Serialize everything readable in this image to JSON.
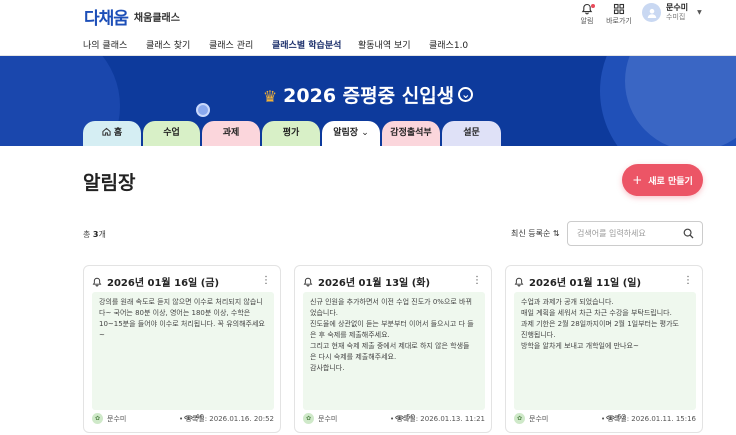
{
  "header": {
    "logo_mark": "다채움",
    "logo_text": "채움클래스",
    "alarm_label": "알림",
    "shortcut_label": "바로가기",
    "user_name": "문수미",
    "user_role": "수미집"
  },
  "nav": {
    "items": [
      "나의 클래스",
      "클래스 찾기",
      "클래스 관리",
      "클래스별 학습분석",
      "활동내역 보기",
      "클래스1.0"
    ],
    "active_index": 3
  },
  "banner": {
    "title": "2026 증평중 신입생"
  },
  "tabs": [
    {
      "label": "홈",
      "color": "#d5eef3"
    },
    {
      "label": "수업",
      "color": "#d8f0c7"
    },
    {
      "label": "과제",
      "color": "#fbd6dc"
    },
    {
      "label": "평가",
      "color": "#d8f0c7"
    },
    {
      "label": "알림장",
      "color": "#ffffff"
    },
    {
      "label": "감정출석부",
      "color": "#fbd6dc"
    },
    {
      "label": "설문",
      "color": "#dfe1f7"
    }
  ],
  "main": {
    "title": "알림장",
    "new_button": "새로 만들기",
    "count_prefix": "총",
    "count": "3",
    "count_suffix": "개",
    "sort_label": "최신 등록순",
    "search_placeholder": "검색어를 입력하세요"
  },
  "cards": [
    {
      "date": "2026년 01월 16일 (금)",
      "body": "강의를 원래 속도로 듣지 않으면 이수로 처리되지 않습니\n다~ 국어는 80분 이상, 영어는 180분 이상, 수학은\n10~15분을 들어야 이수로 처리됩니다. 꼭 유의해주세요\n~",
      "author": "문수미",
      "views": "46",
      "registered": "등록일: 2026.01.16. 20:52"
    },
    {
      "date": "2026년 01월 13일 (화)",
      "body": "신규 인원을 추가하면서 이전 수업 진도가 0%으로 바뀌\n었습니다.\n진도율에 상관없이 듣는 부분부터 이어서 들으시고 다 들\n은 후 숙제를 제출해주세요.\n그리고 현재 숙제 제출 중에서 제대로 하지 않은 학생들\n은 다시 숙제를 제출해주세요.\n감사합니다.",
      "author": "문수미",
      "views": "50",
      "registered": "등록일: 2026.01.13. 11:21"
    },
    {
      "date": "2026년 01월 11일 (일)",
      "body": "수업과 과제가 공개 되었습니다.\n매일 계획을 세워서 차근 차근 수강을 부탁드립니다.\n과제 기한은 2월 28일까지이며 2월 1일부터는 평가도\n진행됩니다.\n방학을 알차게 보내고 개학일에 만나요~",
      "author": "문수미",
      "views": "63",
      "registered": "등록일: 2026.01.11. 15:16"
    }
  ],
  "colors": {
    "banner": "#0d3a9c",
    "accent": "#ec5566",
    "card_body": "#eff8ee"
  }
}
